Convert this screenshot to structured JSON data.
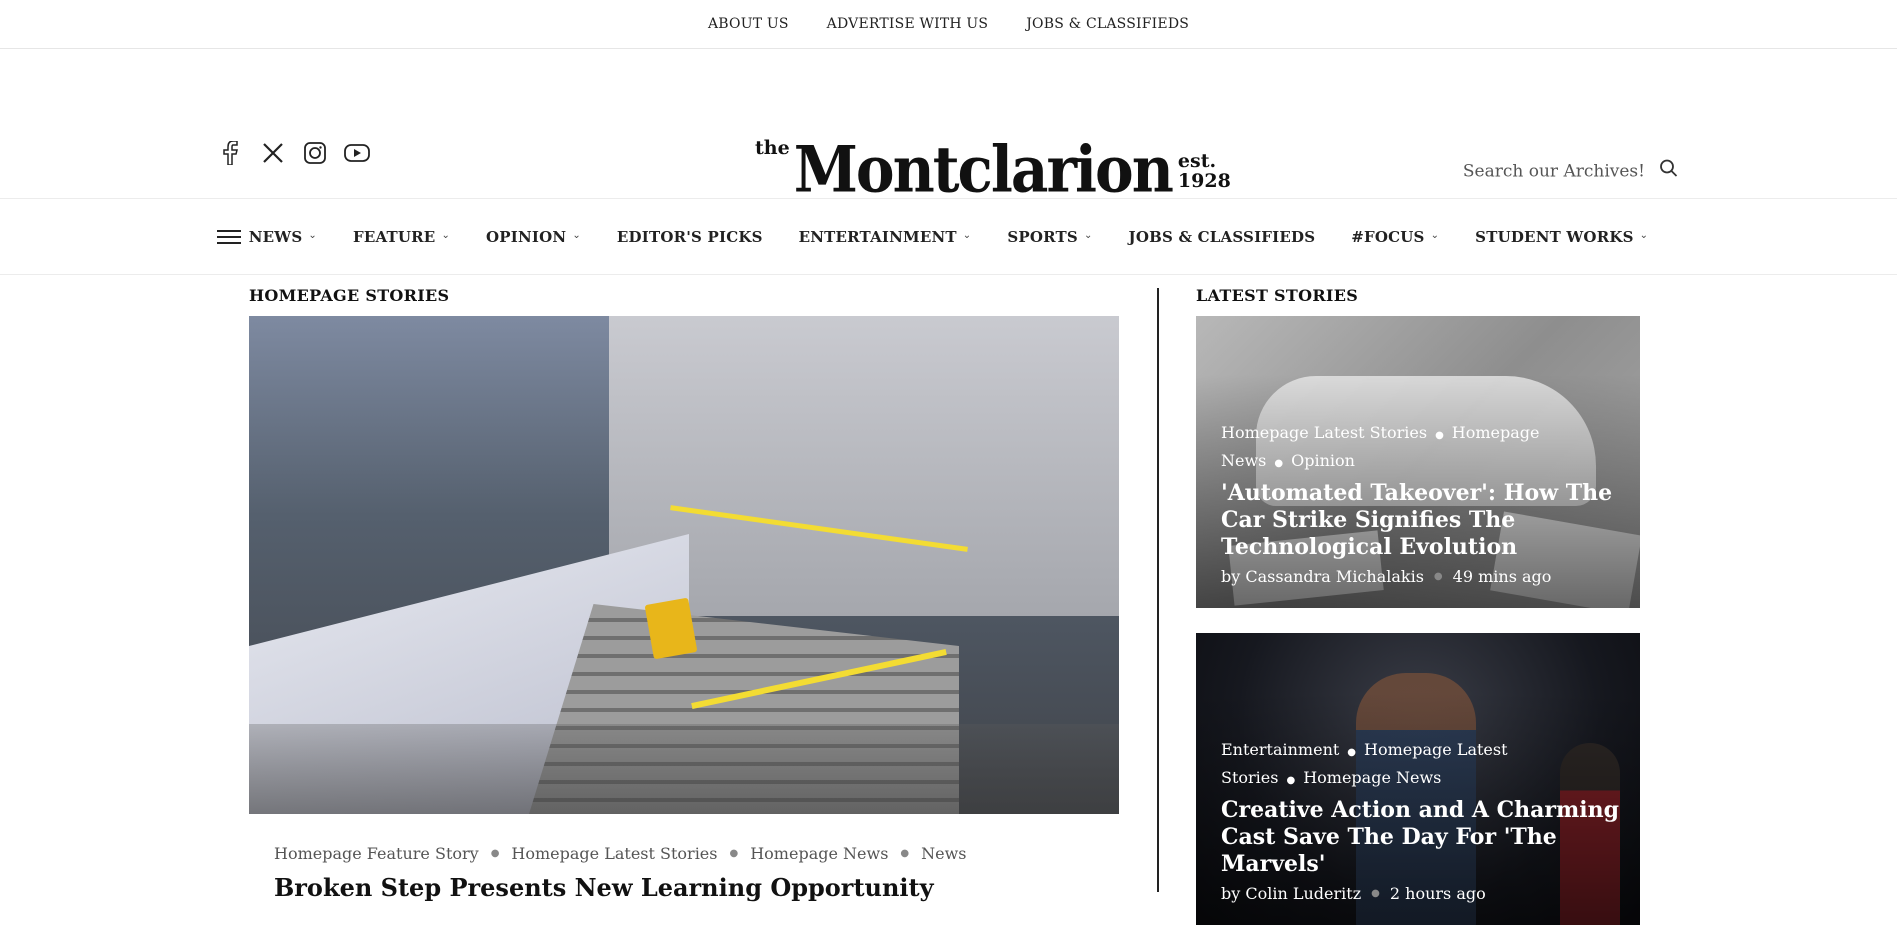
{
  "topbar": {
    "links": [
      "ABOUT US",
      "ADVERTISE WITH US",
      "JOBS & CLASSIFIEDS"
    ]
  },
  "masthead": {
    "logo_the": "the",
    "logo_name": "Montclarion",
    "logo_est": "est.",
    "logo_year": "1928",
    "search_placeholder": "Search our Archives!",
    "social_icons": [
      "facebook-icon",
      "x-icon",
      "instagram-icon",
      "youtube-icon"
    ]
  },
  "nav": {
    "items": [
      {
        "label": "NEWS",
        "dropdown": true
      },
      {
        "label": "FEATURE",
        "dropdown": true
      },
      {
        "label": "OPINION",
        "dropdown": true
      },
      {
        "label": "EDITOR'S PICKS",
        "dropdown": false
      },
      {
        "label": "ENTERTAINMENT",
        "dropdown": true
      },
      {
        "label": "SPORTS",
        "dropdown": true
      },
      {
        "label": "JOBS & CLASSIFIEDS",
        "dropdown": false
      },
      {
        "label": "#FOCUS",
        "dropdown": true
      },
      {
        "label": "STUDENT WORKS",
        "dropdown": true
      }
    ]
  },
  "homepage": {
    "section_title": "HOMEPAGE STORIES",
    "hero": {
      "categories": [
        "Homepage Feature Story",
        "Homepage Latest Stories",
        "Homepage News",
        "News"
      ],
      "title": "Broken Step Presents New Learning Opportunity"
    }
  },
  "latest": {
    "section_title": "LATEST STORIES",
    "stories": [
      {
        "categories": [
          "Homepage Latest Stories",
          "Homepage News",
          "Opinion"
        ],
        "title": "'Automated Takeover': How The Car Strike Signifies The Technological Evolution",
        "author": "by Cassandra Michalakis",
        "time": "49 mins ago"
      },
      {
        "categories": [
          "Entertainment",
          "Homepage Latest Stories",
          "Homepage News"
        ],
        "title": "Creative Action and A Charming Cast Save The Day For 'The Marvels'",
        "author": "by Colin Luderitz",
        "time": "2 hours ago"
      }
    ]
  }
}
